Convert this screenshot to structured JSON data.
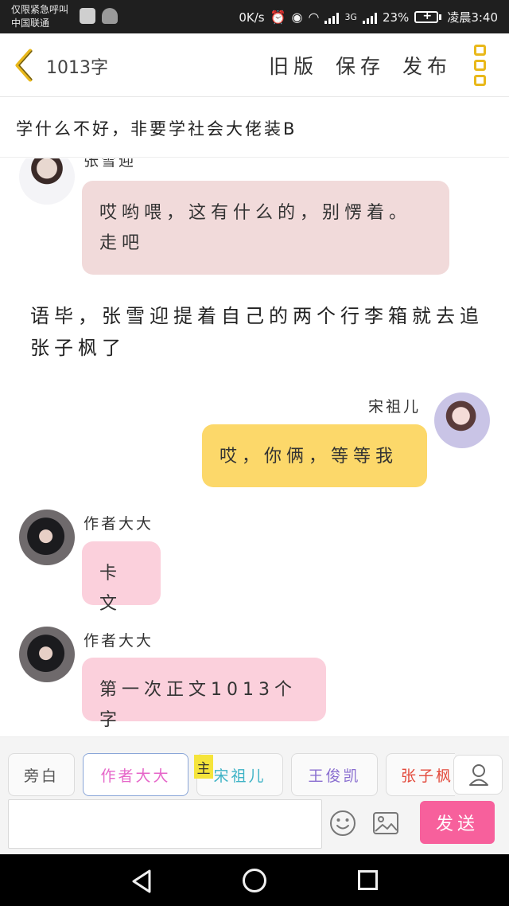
{
  "status_bar": {
    "emergency_text": "仅限紧急呼叫",
    "carrier": "中国联通",
    "net_speed": "0K/s",
    "network_type": "3G",
    "battery": "23%",
    "time": "凌晨3:40"
  },
  "header": {
    "word_count": "1013字",
    "old_version": "旧版",
    "save": "保存",
    "publish": "发布"
  },
  "title": "学什么不好，非要学社会大佬装B",
  "messages": [
    {
      "speaker": "张雪迎",
      "text": "哎哟喂，这有什么的，别愣着。走吧"
    },
    {
      "narration": "语毕，张雪迎提着自己的两个行李箱就去追张子枫了"
    },
    {
      "speaker": "宋祖儿",
      "text": "哎，你俩，等等我"
    },
    {
      "speaker": "作者大大",
      "text": "卡文"
    },
    {
      "speaker": "作者大大",
      "text": "第一次正文1013个字"
    }
  ],
  "roles": [
    {
      "label": "旁白",
      "color": "#555555"
    },
    {
      "label": "作者大大",
      "color": "#e666c9",
      "selected": true
    },
    {
      "label": "宋祖儿",
      "color": "#3fb3c6"
    },
    {
      "label": "王俊凯",
      "color": "#8a6fd0"
    },
    {
      "label": "张子枫",
      "color": "#e34a3c"
    }
  ],
  "host_badge": "主",
  "input": {
    "value": "",
    "placeholder": ""
  },
  "send_label": "发送",
  "icons": {
    "back": "chevron-left-icon",
    "more": "more-vertical-icon",
    "person": "person-icon",
    "emoji": "emoji-icon",
    "image": "image-icon"
  },
  "colors": {
    "accent_yellow": "#e9b81a",
    "send_pink": "#f7609c",
    "bubble_zhang": "#f1dada",
    "bubble_song": "#fcd86a",
    "bubble_author": "#fbd0dc"
  }
}
